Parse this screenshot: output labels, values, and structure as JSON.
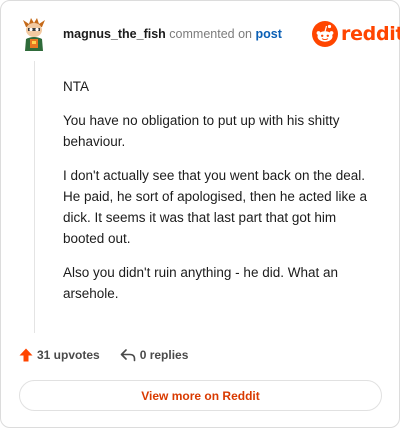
{
  "comment": {
    "username": "magnus_the_fish",
    "action_text": "commented on",
    "post_link": "post",
    "paragraphs": [
      "NTA",
      "You have no obligation to put up with his shitty behaviour.",
      "I don't actually see that you went back on the deal. He paid, he sort of apologised, then he acted like a dick. It seems it was that last part that got him booted out.",
      "Also you didn't ruin anything - he did. What an arsehole."
    ]
  },
  "brand": {
    "wordmark": "reddit",
    "color": "#ff4500"
  },
  "actions": {
    "upvotes": "31 upvotes",
    "replies": "0 replies",
    "upvote_icon": "upvote-arrow-icon",
    "reply_icon": "reply-arrow-icon"
  },
  "view_button": {
    "label": "View more on Reddit",
    "color": "#d93a00"
  }
}
